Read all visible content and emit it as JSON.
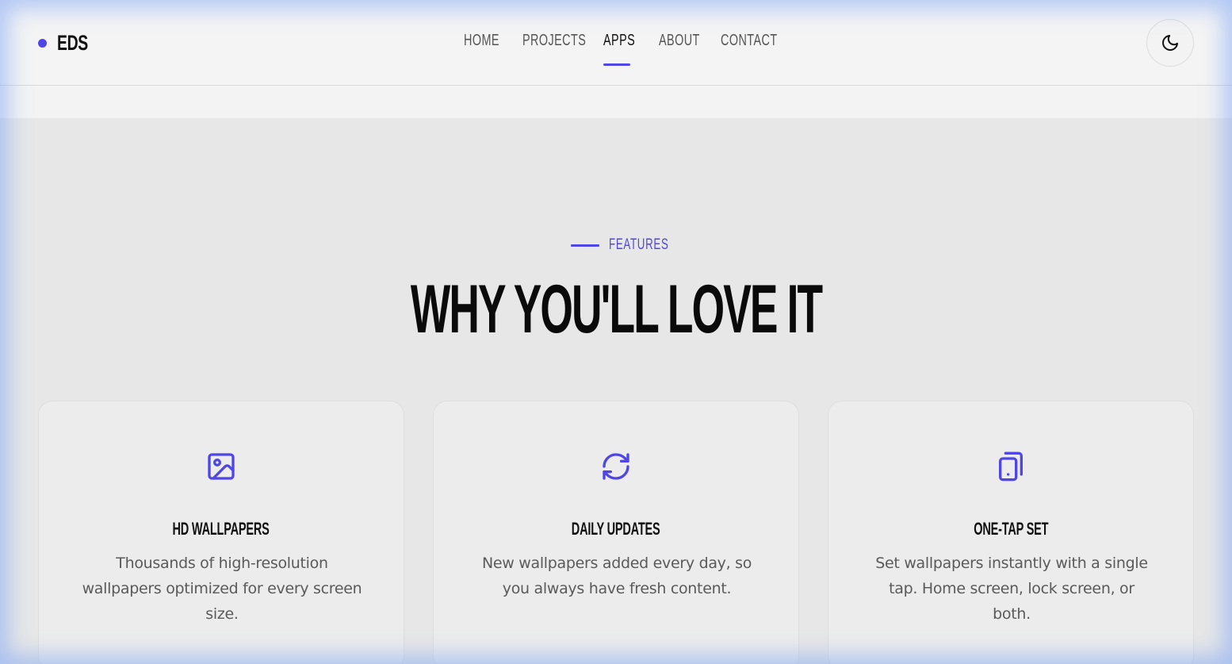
{
  "brand": {
    "name": "EDS",
    "accent": "#4f46e5"
  },
  "nav": {
    "items": [
      {
        "label": "HOME"
      },
      {
        "label": "PROJECTS"
      },
      {
        "label": "APPS"
      },
      {
        "label": "ABOUT"
      },
      {
        "label": "CONTACT"
      }
    ],
    "active": "APPS"
  },
  "theme_toggle": {
    "icon": "moon-icon"
  },
  "features": {
    "eyebrow": "FEATURES",
    "headline": "WHY YOU'LL LOVE IT",
    "cards": [
      {
        "icon": "image-icon",
        "title": "HD WALLPAPERS",
        "description": "Thousands of high-resolution wallpapers optimized for every screen size."
      },
      {
        "icon": "refresh-icon",
        "title": "DAILY UPDATES",
        "description": "New wallpapers added every day, so you always have fresh content."
      },
      {
        "icon": "phone-icon",
        "title": "ONE-TAP SET",
        "description": "Set wallpapers instantly with a single tap. Home screen, lock screen, or both."
      }
    ]
  }
}
